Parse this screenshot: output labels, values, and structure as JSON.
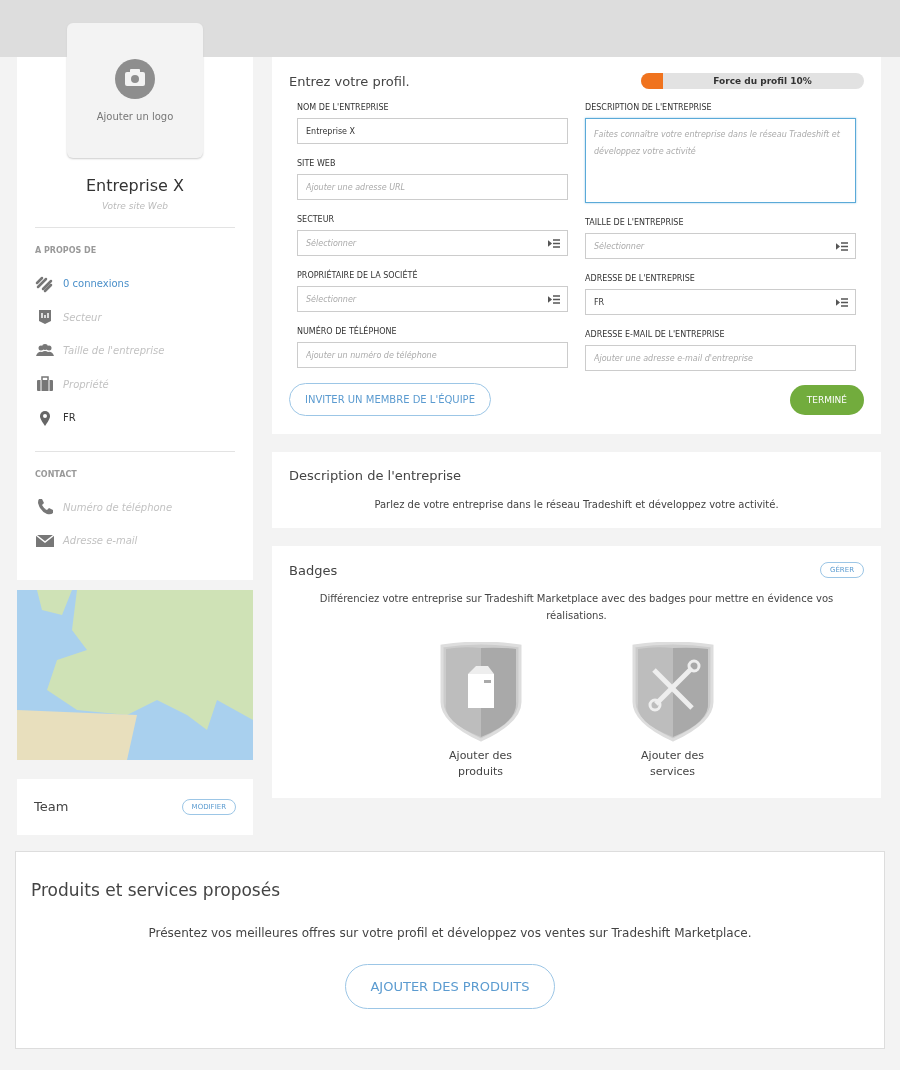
{
  "sidebar": {
    "logo_label": "Ajouter un logo",
    "company_name": "Entreprise X",
    "website": "Votre site Web",
    "about": {
      "heading": "A PROPOS DE",
      "items": [
        {
          "text": "0 connexions",
          "kind": "link"
        },
        {
          "text": "Secteur",
          "kind": "empty"
        },
        {
          "text": "Taille de l'entreprise",
          "kind": "empty"
        },
        {
          "text": "Propriété",
          "kind": "empty"
        },
        {
          "text": "FR",
          "kind": "value"
        }
      ]
    },
    "contact": {
      "heading": "CONTACT",
      "items": [
        {
          "text": "Numéro de téléphone",
          "kind": "empty"
        },
        {
          "text": "Adresse e-mail",
          "kind": "empty"
        }
      ]
    },
    "team": {
      "title": "Team",
      "button": "MODIFIER"
    }
  },
  "profile": {
    "title": "Entrez votre profil.",
    "strength": {
      "label": "Force du profil 10%",
      "level": 0.1
    },
    "columns": [
      [
        {
          "label": "NOM DE L'ENTREPRISE",
          "kind": "text",
          "value": "Entreprise X",
          "focused": false
        },
        {
          "label": "SITE WEB",
          "kind": "text",
          "placeholder": "Ajouter une adresse URL",
          "focused": false
        },
        {
          "label": "SECTEUR",
          "kind": "select",
          "placeholder": "Sélectionner",
          "focused": false
        },
        {
          "label": "PROPRIÉTAIRE DE LA SOCIÉTÉ",
          "kind": "select",
          "placeholder": "Sélectionner",
          "focused": false
        },
        {
          "label": "NUMÉRO DE TÉLÉPHONE",
          "kind": "text",
          "placeholder": "Ajouter un numéro de téléphone",
          "focused": false
        }
      ],
      [
        {
          "label": "DESCRIPTION DE L'ENTREPRISE",
          "kind": "textarea",
          "placeholder": "Faites connaître votre entreprise dans le réseau Tradeshift et développez votre activité",
          "focused": true
        },
        {
          "label": "TAILLE DE L'ENTREPRISE",
          "kind": "select",
          "placeholder": "Sélectionner",
          "focused": false
        },
        {
          "label": "ADRESSE DE L'ENTREPRISE",
          "kind": "select",
          "value": "FR",
          "focused": false
        },
        {
          "label": "ADRESSE E-MAIL DE L'ENTREPRISE",
          "kind": "text",
          "placeholder": "Ajouter une adresse e-mail d'entreprise",
          "focused": false
        }
      ]
    ],
    "invite_button": "INVITER UN MEMBRE DE L'ÉQUIPE",
    "done_button": "TERMINÉ"
  },
  "description": {
    "title": "Description de l'entreprise",
    "text": "Parlez de votre entreprise dans le réseau Tradeshift et développez votre activité."
  },
  "badges": {
    "title": "Badges",
    "button": "GÉRER",
    "text": "Différenciez votre entreprise sur Tradeshift Marketplace avec des badges pour mettre en évidence vos réalisations.",
    "items": [
      {
        "label": "Ajouter des produits",
        "kind": "products"
      },
      {
        "label": "Ajouter des services",
        "kind": "services"
      }
    ]
  },
  "offers": {
    "title": "Produits et services proposés",
    "text": "Présentez vos meilleures offres sur votre profil et développez vos ventes sur Tradeshift Marketplace.",
    "button": "AJOUTER DES PRODUITS"
  }
}
